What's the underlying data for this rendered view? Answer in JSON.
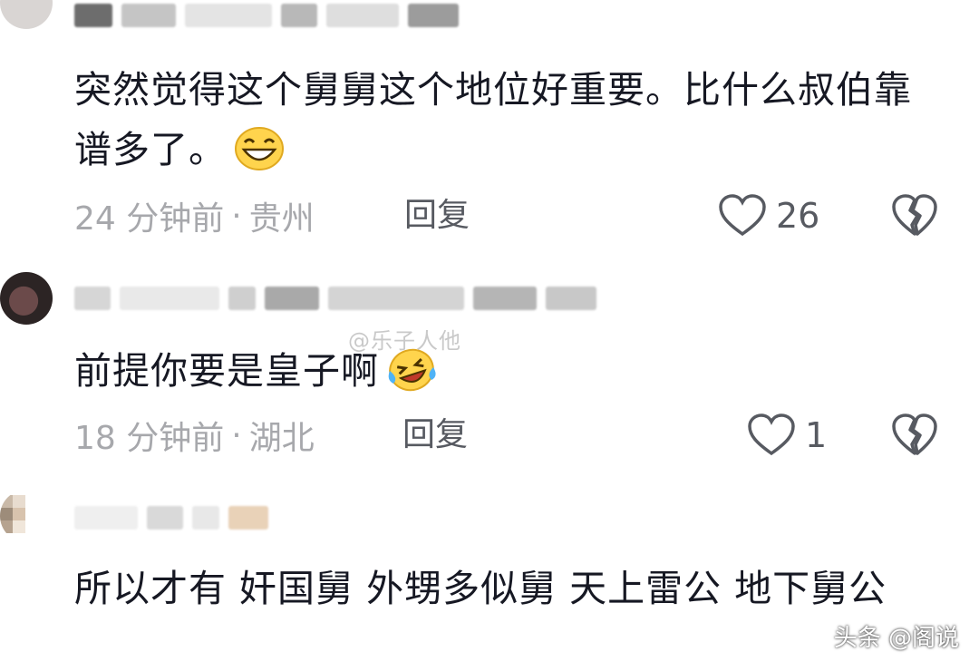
{
  "comments": [
    {
      "text": "突然觉得这个舅舅这个地位好重要。比什么叔伯靠谱多了。",
      "time": "24 分钟前",
      "location": "贵州",
      "reply_label": "回复",
      "likes": "26",
      "emoji": "grin-icon"
    },
    {
      "text": "前提你要是皇子啊",
      "time": "18 分钟前",
      "location": "湖北",
      "reply_label": "回复",
      "likes": "1",
      "emoji": "laughing-tears-icon"
    },
    {
      "text": "所以才有 奸国舅 外甥多似舅 天上雷公 地下舅公"
    }
  ],
  "separator": "·",
  "watermark": "头条 @阁说",
  "inline_watermark": "@乐子人他"
}
